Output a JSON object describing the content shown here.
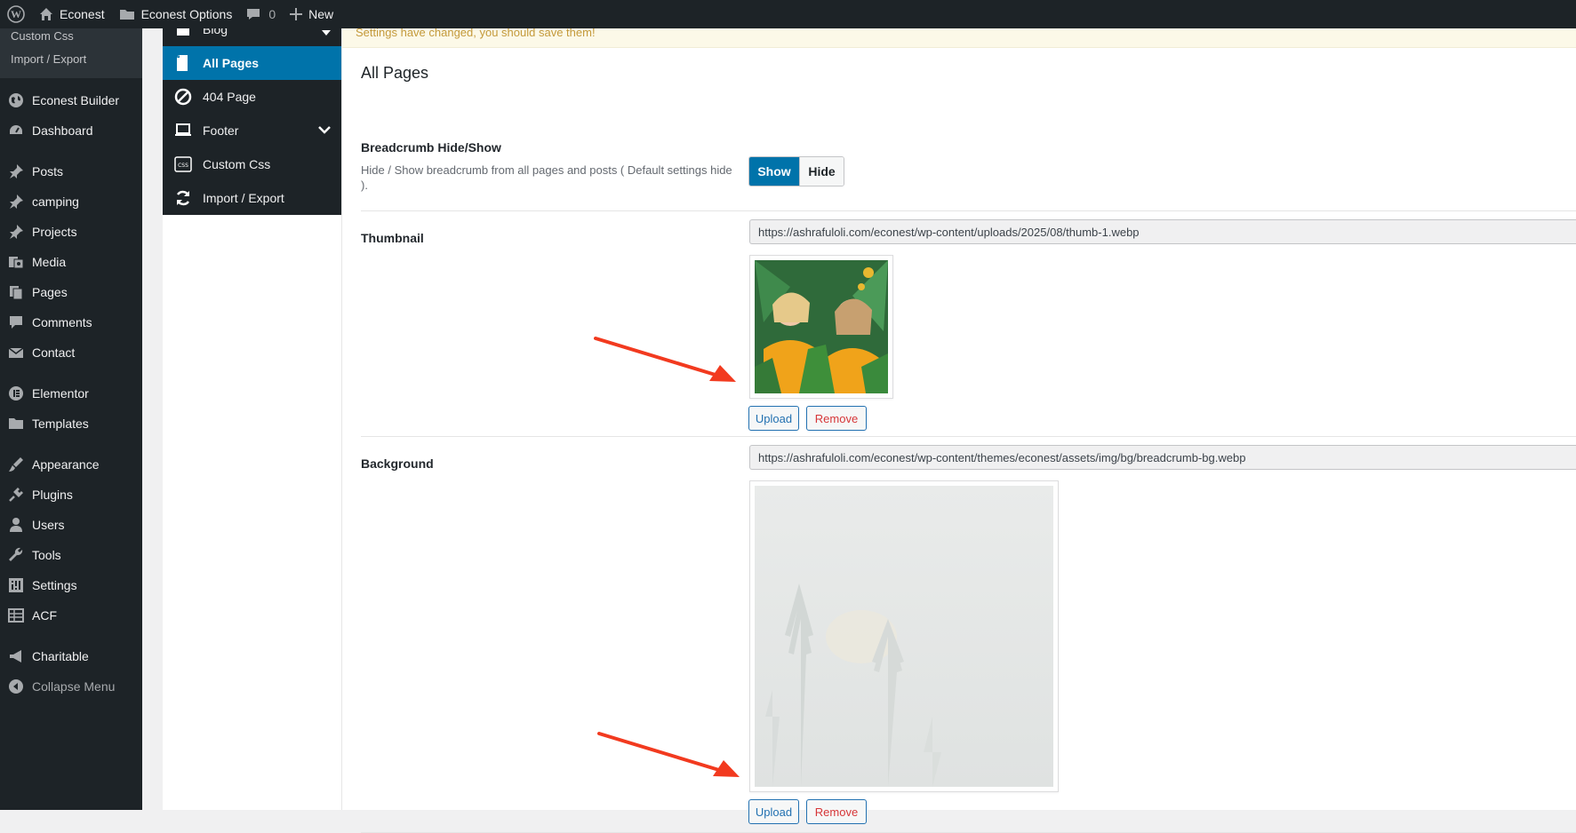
{
  "adminbar": {
    "site_name": "Econest",
    "options_name": "Econest Options",
    "comments_count": "0",
    "new_label": "New"
  },
  "admin_menu": {
    "submenu": [
      "Custom Css",
      "Import / Export"
    ],
    "items": [
      {
        "label": "Econest Builder",
        "icon": "globe-icon"
      },
      {
        "label": "Dashboard",
        "icon": "dashboard-icon"
      },
      {
        "label": "Posts",
        "icon": "pin-icon"
      },
      {
        "label": "camping",
        "icon": "pin-icon"
      },
      {
        "label": "Projects",
        "icon": "pin-icon"
      },
      {
        "label": "Media",
        "icon": "media-icon"
      },
      {
        "label": "Pages",
        "icon": "pages-icon"
      },
      {
        "label": "Comments",
        "icon": "comment-icon"
      },
      {
        "label": "Contact",
        "icon": "mail-icon"
      },
      {
        "label": "Elementor",
        "icon": "elementor-icon"
      },
      {
        "label": "Templates",
        "icon": "folder-icon"
      },
      {
        "label": "Appearance",
        "icon": "brush-icon"
      },
      {
        "label": "Plugins",
        "icon": "plug-icon"
      },
      {
        "label": "Users",
        "icon": "user-icon"
      },
      {
        "label": "Tools",
        "icon": "wrench-icon"
      },
      {
        "label": "Settings",
        "icon": "settings-icon"
      },
      {
        "label": "ACF",
        "icon": "grid-icon"
      },
      {
        "label": "Charitable",
        "icon": "megaphone-icon"
      }
    ],
    "collapse_label": "Collapse Menu"
  },
  "options_nav": {
    "items": [
      {
        "label": "Blog",
        "icon": "blog-icon"
      },
      {
        "label": "All Pages",
        "icon": "page-icon"
      },
      {
        "label": "404 Page",
        "icon": "ban-icon"
      },
      {
        "label": "Footer",
        "icon": "laptop-icon"
      },
      {
        "label": "Custom Css",
        "icon": "css-icon"
      },
      {
        "label": "Import / Export",
        "icon": "refresh-icon"
      }
    ]
  },
  "notice": "Settings have changed, you should save them!",
  "section_title": "All Pages",
  "breadcrumb": {
    "label": "Breadcrumb Hide/Show",
    "description": "Hide / Show breadcrumb from all pages and posts ( Default settings hide ).",
    "on_label": "Show",
    "off_label": "Hide"
  },
  "thumbnail": {
    "label": "Thumbnail",
    "url": "https://ashrafuloli.com/econest/wp-content/uploads/2025/08/thumb-1.webp",
    "upload_label": "Upload",
    "remove_label": "Remove"
  },
  "background": {
    "label": "Background",
    "url": "https://ashrafuloli.com/econest/wp-content/themes/econest/assets/img/bg/breadcrumb-bg.webp",
    "upload_label": "Upload",
    "remove_label": "Remove"
  },
  "colors": {
    "accent": "#0073aa",
    "admin_dark": "#1d2327",
    "annotation_arrow": "#f23a1f"
  }
}
